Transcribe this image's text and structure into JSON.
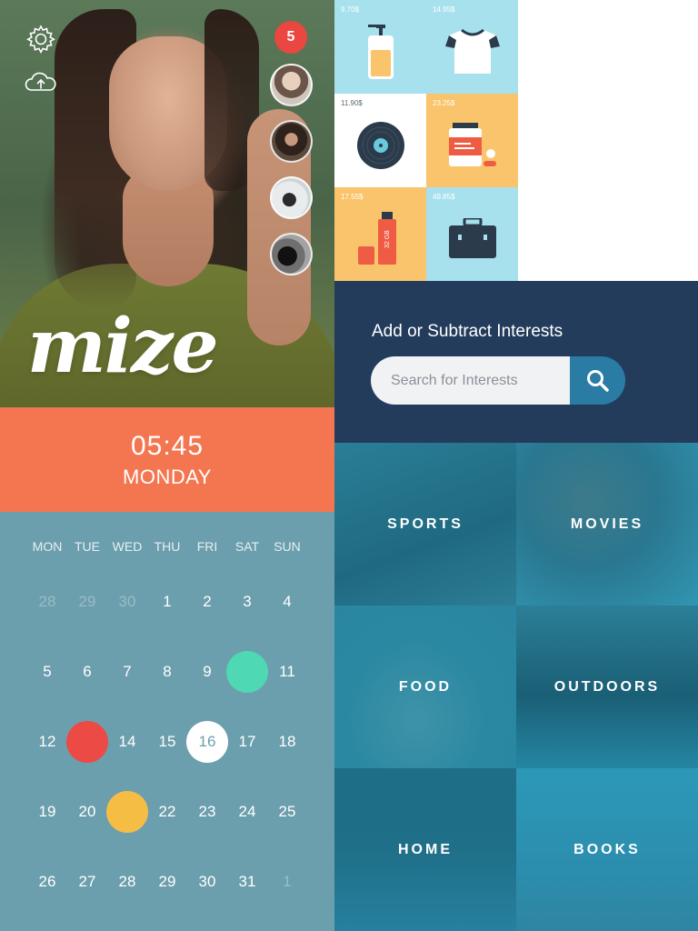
{
  "app": {
    "logo": "mize"
  },
  "hero": {
    "notifications": "5",
    "icons": {
      "settings": "gear-icon",
      "upload": "cloud-upload-icon"
    },
    "avatars": [
      "avatar-1",
      "avatar-2",
      "avatar-3",
      "avatar-4"
    ]
  },
  "clock": {
    "time": "05:45",
    "day": "MONDAY"
  },
  "calendar": {
    "weekdays": [
      "MON",
      "TUE",
      "WED",
      "THU",
      "FRI",
      "SAT",
      "SUN"
    ],
    "days": [
      {
        "n": "28",
        "muted": true
      },
      {
        "n": "29",
        "muted": true
      },
      {
        "n": "30",
        "muted": true
      },
      {
        "n": "1"
      },
      {
        "n": "2"
      },
      {
        "n": "3"
      },
      {
        "n": "4"
      },
      {
        "n": "5"
      },
      {
        "n": "6"
      },
      {
        "n": "7"
      },
      {
        "n": "8"
      },
      {
        "n": "9"
      },
      {
        "n": "",
        "dot": "#4fd8b4"
      },
      {
        "n": "11"
      },
      {
        "n": "12"
      },
      {
        "n": "",
        "dot": "#ec4a45"
      },
      {
        "n": "14"
      },
      {
        "n": "15"
      },
      {
        "n": "16",
        "today": true
      },
      {
        "n": "17"
      },
      {
        "n": "18"
      },
      {
        "n": "19"
      },
      {
        "n": "20"
      },
      {
        "n": "",
        "dot": "#f6bd45"
      },
      {
        "n": "22"
      },
      {
        "n": "23"
      },
      {
        "n": "24"
      },
      {
        "n": "25"
      },
      {
        "n": "26"
      },
      {
        "n": "27"
      },
      {
        "n": "28"
      },
      {
        "n": "29"
      },
      {
        "n": "30"
      },
      {
        "n": "31"
      },
      {
        "n": "1",
        "muted": true
      }
    ]
  },
  "shop": {
    "items": [
      {
        "price": "9.70$",
        "icon": "soap-bottle-icon",
        "bg": "blue"
      },
      {
        "price": "14.95$",
        "icon": "tshirt-icon",
        "bg": "blue"
      },
      {
        "price": "11.90$",
        "icon": "vinyl-record-icon",
        "bg": "white"
      },
      {
        "price": "23.25$",
        "icon": "pill-jar-icon",
        "bg": "yellow"
      },
      {
        "price": "17.55$",
        "icon": "usb-drive-icon",
        "bg": "yellow"
      },
      {
        "price": "49.85$",
        "icon": "briefcase-icon",
        "bg": "blue"
      }
    ]
  },
  "interests": {
    "title": "Add or Subtract Interests",
    "search_placeholder": "Search for Interests",
    "search_icon": "search-icon"
  },
  "categories": [
    {
      "label": "SPORTS"
    },
    {
      "label": "MOVIES"
    },
    {
      "label": "FOOD"
    },
    {
      "label": "OUTDOORS"
    },
    {
      "label": "HOME"
    },
    {
      "label": "BOOKS"
    }
  ],
  "colors": {
    "clock_bg": "#f47650",
    "calendar_bg": "#6c9fad",
    "interests_bg": "#243c5c",
    "search_button": "#2a7ca4",
    "badge": "#e9473f"
  }
}
